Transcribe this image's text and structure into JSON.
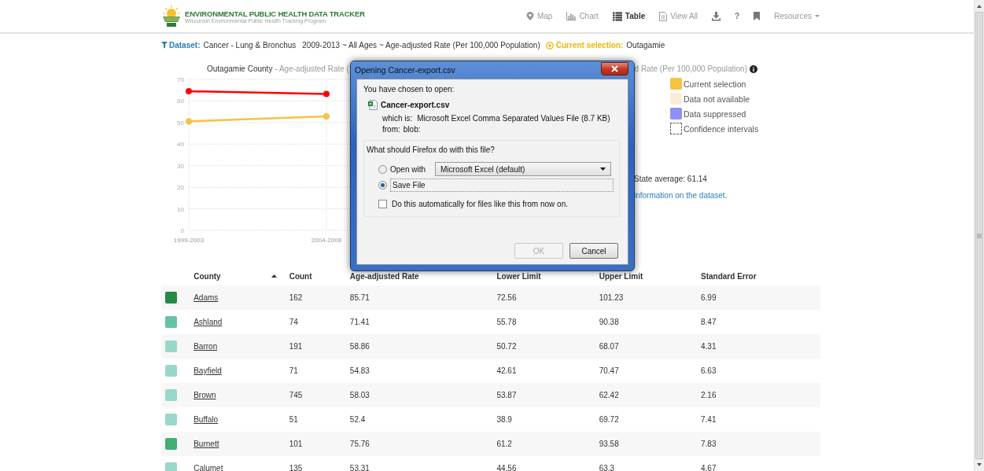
{
  "header": {
    "logo_title": "ENVIRONMENTAL PUBLIC HEALTH DATA TRACKER",
    "logo_subtitle": "Wisconsin Environmental Public Health Tracking Program",
    "nav": [
      {
        "kind": "map",
        "label": "Map",
        "selected": false
      },
      {
        "kind": "chart",
        "label": "Chart",
        "selected": false
      },
      {
        "kind": "table",
        "label": "Table",
        "selected": true
      },
      {
        "kind": "view_all",
        "label": "View All",
        "selected": false
      },
      {
        "kind": "download",
        "selected": false
      },
      {
        "kind": "help",
        "label": "?",
        "selected": false
      },
      {
        "kind": "bookmark",
        "selected": false
      },
      {
        "kind": "resources",
        "label": "Resources",
        "selected": false
      }
    ]
  },
  "dataset_bar": {
    "dataset_label": "Dataset:",
    "dataset": "Cancer - Lung & Bronchus",
    "details": "2009-2013 ~ All Ages ~ Age-adjusted Rate (Per 100,000 Population)",
    "selection_label": "Current selection:",
    "selection": "Outagamie"
  },
  "chart_panel": {
    "title_county": "Outagamie County",
    "title_start": "- Age-adjusted Rate (",
    "title_end": "d Rate (Per 100,000 Population)",
    "chart_data": {
      "type": "line",
      "grid": true,
      "categories": [
        "1999-2003",
        "2004-2008"
      ],
      "ylim": [
        0,
        70
      ],
      "yticks": [
        0,
        10,
        20,
        30,
        40,
        50,
        60,
        70
      ],
      "series": [
        {
          "color": "#ff0000",
          "marker": "circle",
          "values": [
            64.5,
            63.3
          ]
        },
        {
          "color": "#f5c242",
          "marker": "circle",
          "values": [
            50.6,
            52.9
          ]
        }
      ]
    },
    "legend": [
      {
        "kind": "swatch",
        "label": "Current selection",
        "color": "#f5c242"
      },
      {
        "kind": "swatch",
        "label": "Data not available",
        "color": "#fdebd9"
      },
      {
        "kind": "swatch",
        "label": "Data suppressed",
        "color": "#8f8ff7"
      },
      {
        "kind": "outline",
        "label": "Confidence intervals"
      }
    ],
    "state_average": "State average: 61.14",
    "dataset_link": "information on the dataset."
  },
  "table": {
    "columns": [
      {
        "label": "County",
        "sorted": true
      },
      {
        "label": "Count",
        "sorted": false
      },
      {
        "label": "Age-adjusted Rate",
        "sorted": false
      },
      {
        "label": "Lower Limit",
        "sorted": false
      },
      {
        "label": "Upper Limit",
        "sorted": false
      },
      {
        "label": "Standard Error",
        "sorted": false
      }
    ],
    "rows": [
      {
        "color": "#238b45",
        "cells": [
          "Adams",
          "162",
          "85.71",
          "72.56",
          "101.23",
          "6.99"
        ]
      },
      {
        "color": "#66c2a4",
        "cells": [
          "Ashland",
          "74",
          "71.41",
          "55.78",
          "90.38",
          "8.47"
        ]
      },
      {
        "color": "#99d8c9",
        "cells": [
          "Barron",
          "191",
          "58.86",
          "50.72",
          "68.07",
          "4.31"
        ]
      },
      {
        "color": "#99d8c9",
        "cells": [
          "Bayfield",
          "71",
          "54.83",
          "42.61",
          "70.47",
          "6.63"
        ]
      },
      {
        "color": "#99d8c9",
        "cells": [
          "Brown",
          "745",
          "58.03",
          "53.87",
          "62.42",
          "2.16"
        ]
      },
      {
        "color": "#99d8c9",
        "cells": [
          "Buffalo",
          "51",
          "52.4",
          "38.9",
          "69.72",
          "7.41"
        ]
      },
      {
        "color": "#41ae76",
        "cells": [
          "Burnett",
          "101",
          "75.76",
          "61.2",
          "93.58",
          "7.83"
        ]
      },
      {
        "color": "#99d8c9",
        "cells": [
          "Calumet",
          "135",
          "53.31",
          "44.56",
          "63.3",
          "4.67"
        ]
      }
    ]
  },
  "dialog": {
    "title": "Opening Cancer-export.csv",
    "intro": "You have chosen to open:",
    "file_name": "Cancer-export.csv",
    "type_label": "which is:",
    "type_value": "Microsoft Excel Comma Separated Values File (8.7 KB)",
    "from_label": "from:",
    "from_value": "blob:",
    "question": "What should Firefox do with this file?",
    "options": [
      {
        "label": "Open with",
        "selected": false
      },
      {
        "label": "Save File",
        "selected": true
      }
    ],
    "app_select": "Microsoft Excel (default)",
    "auto_checkbox": {
      "label": "Do this automatically for files like this from now on.",
      "checked": false
    },
    "buttons": [
      {
        "label": "OK",
        "disabled": true
      },
      {
        "label": "Cancel",
        "disabled": false
      }
    ]
  }
}
